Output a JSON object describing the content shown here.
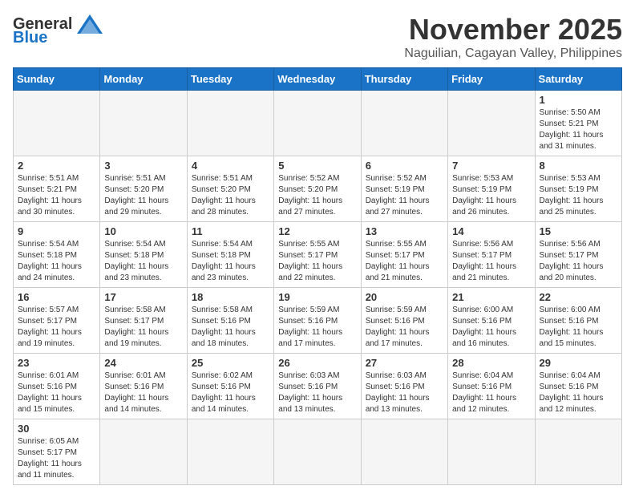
{
  "logo": {
    "text_general": "General",
    "text_blue": "Blue"
  },
  "header": {
    "month": "November 2025",
    "location": "Naguilian, Cagayan Valley, Philippines"
  },
  "weekdays": [
    "Sunday",
    "Monday",
    "Tuesday",
    "Wednesday",
    "Thursday",
    "Friday",
    "Saturday"
  ],
  "weeks": [
    [
      {
        "day": "",
        "info": ""
      },
      {
        "day": "",
        "info": ""
      },
      {
        "day": "",
        "info": ""
      },
      {
        "day": "",
        "info": ""
      },
      {
        "day": "",
        "info": ""
      },
      {
        "day": "",
        "info": ""
      },
      {
        "day": "1",
        "info": "Sunrise: 5:50 AM\nSunset: 5:21 PM\nDaylight: 11 hours and 31 minutes."
      }
    ],
    [
      {
        "day": "2",
        "info": "Sunrise: 5:51 AM\nSunset: 5:21 PM\nDaylight: 11 hours and 30 minutes."
      },
      {
        "day": "3",
        "info": "Sunrise: 5:51 AM\nSunset: 5:20 PM\nDaylight: 11 hours and 29 minutes."
      },
      {
        "day": "4",
        "info": "Sunrise: 5:51 AM\nSunset: 5:20 PM\nDaylight: 11 hours and 28 minutes."
      },
      {
        "day": "5",
        "info": "Sunrise: 5:52 AM\nSunset: 5:20 PM\nDaylight: 11 hours and 27 minutes."
      },
      {
        "day": "6",
        "info": "Sunrise: 5:52 AM\nSunset: 5:19 PM\nDaylight: 11 hours and 27 minutes."
      },
      {
        "day": "7",
        "info": "Sunrise: 5:53 AM\nSunset: 5:19 PM\nDaylight: 11 hours and 26 minutes."
      },
      {
        "day": "8",
        "info": "Sunrise: 5:53 AM\nSunset: 5:19 PM\nDaylight: 11 hours and 25 minutes."
      }
    ],
    [
      {
        "day": "9",
        "info": "Sunrise: 5:54 AM\nSunset: 5:18 PM\nDaylight: 11 hours and 24 minutes."
      },
      {
        "day": "10",
        "info": "Sunrise: 5:54 AM\nSunset: 5:18 PM\nDaylight: 11 hours and 23 minutes."
      },
      {
        "day": "11",
        "info": "Sunrise: 5:54 AM\nSunset: 5:18 PM\nDaylight: 11 hours and 23 minutes."
      },
      {
        "day": "12",
        "info": "Sunrise: 5:55 AM\nSunset: 5:17 PM\nDaylight: 11 hours and 22 minutes."
      },
      {
        "day": "13",
        "info": "Sunrise: 5:55 AM\nSunset: 5:17 PM\nDaylight: 11 hours and 21 minutes."
      },
      {
        "day": "14",
        "info": "Sunrise: 5:56 AM\nSunset: 5:17 PM\nDaylight: 11 hours and 21 minutes."
      },
      {
        "day": "15",
        "info": "Sunrise: 5:56 AM\nSunset: 5:17 PM\nDaylight: 11 hours and 20 minutes."
      }
    ],
    [
      {
        "day": "16",
        "info": "Sunrise: 5:57 AM\nSunset: 5:17 PM\nDaylight: 11 hours and 19 minutes."
      },
      {
        "day": "17",
        "info": "Sunrise: 5:58 AM\nSunset: 5:17 PM\nDaylight: 11 hours and 19 minutes."
      },
      {
        "day": "18",
        "info": "Sunrise: 5:58 AM\nSunset: 5:16 PM\nDaylight: 11 hours and 18 minutes."
      },
      {
        "day": "19",
        "info": "Sunrise: 5:59 AM\nSunset: 5:16 PM\nDaylight: 11 hours and 17 minutes."
      },
      {
        "day": "20",
        "info": "Sunrise: 5:59 AM\nSunset: 5:16 PM\nDaylight: 11 hours and 17 minutes."
      },
      {
        "day": "21",
        "info": "Sunrise: 6:00 AM\nSunset: 5:16 PM\nDaylight: 11 hours and 16 minutes."
      },
      {
        "day": "22",
        "info": "Sunrise: 6:00 AM\nSunset: 5:16 PM\nDaylight: 11 hours and 15 minutes."
      }
    ],
    [
      {
        "day": "23",
        "info": "Sunrise: 6:01 AM\nSunset: 5:16 PM\nDaylight: 11 hours and 15 minutes."
      },
      {
        "day": "24",
        "info": "Sunrise: 6:01 AM\nSunset: 5:16 PM\nDaylight: 11 hours and 14 minutes."
      },
      {
        "day": "25",
        "info": "Sunrise: 6:02 AM\nSunset: 5:16 PM\nDaylight: 11 hours and 14 minutes."
      },
      {
        "day": "26",
        "info": "Sunrise: 6:03 AM\nSunset: 5:16 PM\nDaylight: 11 hours and 13 minutes."
      },
      {
        "day": "27",
        "info": "Sunrise: 6:03 AM\nSunset: 5:16 PM\nDaylight: 11 hours and 13 minutes."
      },
      {
        "day": "28",
        "info": "Sunrise: 6:04 AM\nSunset: 5:16 PM\nDaylight: 11 hours and 12 minutes."
      },
      {
        "day": "29",
        "info": "Sunrise: 6:04 AM\nSunset: 5:16 PM\nDaylight: 11 hours and 12 minutes."
      }
    ],
    [
      {
        "day": "30",
        "info": "Sunrise: 6:05 AM\nSunset: 5:17 PM\nDaylight: 11 hours and 11 minutes."
      },
      {
        "day": "",
        "info": ""
      },
      {
        "day": "",
        "info": ""
      },
      {
        "day": "",
        "info": ""
      },
      {
        "day": "",
        "info": ""
      },
      {
        "day": "",
        "info": ""
      },
      {
        "day": "",
        "info": ""
      }
    ]
  ]
}
